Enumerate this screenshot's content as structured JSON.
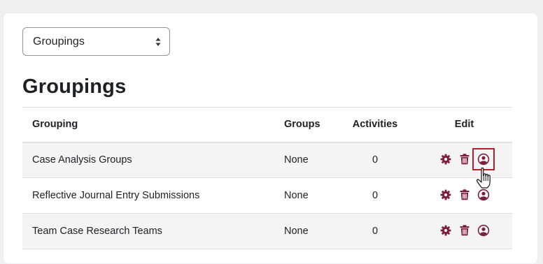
{
  "selector": {
    "selected": "Groupings"
  },
  "page_title": "Groupings",
  "table": {
    "headers": {
      "grouping": "Grouping",
      "groups": "Groups",
      "activities": "Activities",
      "edit": "Edit"
    },
    "rows": [
      {
        "grouping": "Case Analysis Groups",
        "groups": "None",
        "activities": "0"
      },
      {
        "grouping": "Reflective Journal Entry Submissions",
        "groups": "None",
        "activities": "0"
      },
      {
        "grouping": "Team Case Research Teams",
        "groups": "None",
        "activities": "0"
      }
    ]
  },
  "icons": {
    "settings": "gear-icon",
    "delete": "trash-icon",
    "members": "user-circle-icon",
    "cursor": "hand-pointer-icon"
  },
  "colors": {
    "accent": "#7b1f3a",
    "focus_outline": "#b5202c"
  }
}
